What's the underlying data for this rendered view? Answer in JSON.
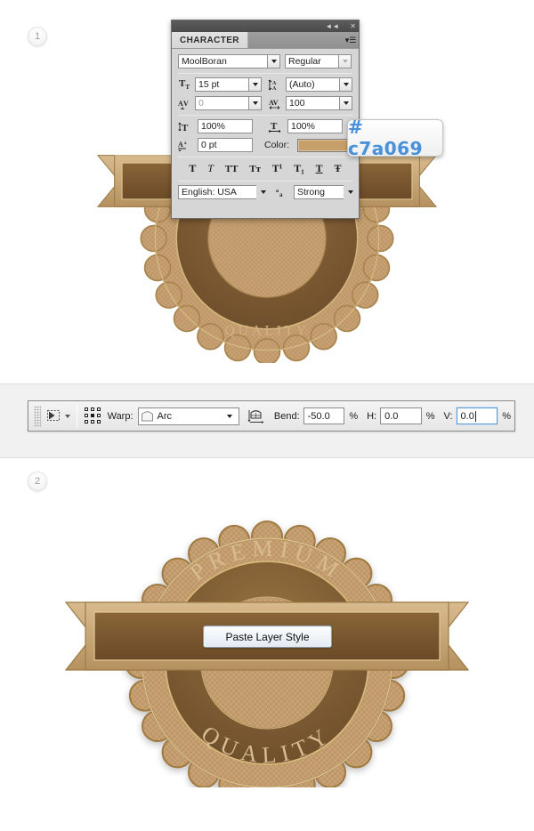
{
  "steps": [
    {
      "number": "1"
    },
    {
      "number": "2"
    }
  ],
  "character_panel": {
    "title": "CHARACTER",
    "window_icons": {
      "collapse": "collapse-icon",
      "close": "close-icon",
      "menu": "panel-menu-icon"
    },
    "font_family": "MoolBoran",
    "font_style": "Regular",
    "font_size": "15 pt",
    "leading": "(Auto)",
    "kerning": "0",
    "tracking": "100",
    "vertical_scale": "100%",
    "horizontal_scale": "100%",
    "baseline_shift": "0 pt",
    "color_label": "Color:",
    "color_value": "#c7a069",
    "style_buttons": [
      {
        "name": "faux-bold",
        "glyph": "T"
      },
      {
        "name": "faux-italic",
        "glyph": "T"
      },
      {
        "name": "all-caps",
        "glyph": "TT"
      },
      {
        "name": "small-caps",
        "glyph": "Tᴛ"
      },
      {
        "name": "superscript",
        "glyph": "T¹"
      },
      {
        "name": "subscript",
        "glyph": "T₁"
      },
      {
        "name": "underline",
        "glyph": "T"
      },
      {
        "name": "strikethrough",
        "glyph": "Ŧ"
      }
    ],
    "language": "English: USA",
    "antialias_label": "aa",
    "antialias": "Strong",
    "icons": {
      "size": "font-size-icon",
      "leading": "leading-icon",
      "kerning": "kerning-icon",
      "tracking": "tracking-icon",
      "vscale": "vertical-scale-icon",
      "hscale": "horizontal-scale-icon",
      "baseline": "baseline-shift-icon"
    }
  },
  "hex_callout": {
    "text": "# c7a069",
    "color": "#4a90d9"
  },
  "warp_toolbar": {
    "move_tool_icon": "move-selection-icon",
    "reference_point_icon": "reference-point-locator-icon",
    "warp_label": "Warp:",
    "warp_value": "Arc",
    "warp_shape_icon": "warp-arc-icon",
    "orientation_icon": "change-warp-orientation-icon",
    "bend_label": "Bend:",
    "bend_value": "-50.0",
    "bend_unit": "%",
    "h_label": "H:",
    "h_value": "0.0",
    "h_unit": "%",
    "v_label": "V:",
    "v_value": "0.0",
    "v_unit": "%"
  },
  "paste_layer_style": {
    "label": "Paste Layer Style"
  },
  "badge": {
    "top_text": "PREMIUM",
    "bottom_text": "QUALITY",
    "colors": {
      "tan": "#c7a069",
      "tan_light": "#d4b286",
      "brown": "#7a5a35",
      "brown_dark": "#6b4d2c",
      "gold": "#e8d49a"
    }
  }
}
